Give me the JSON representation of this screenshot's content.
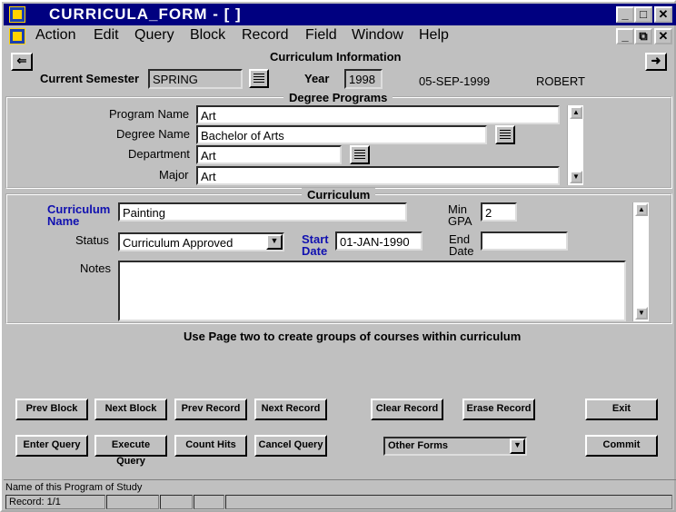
{
  "window": {
    "title": "CURRICULA_FORM - [ ]",
    "minimize": "_",
    "maximize": "□",
    "close": "✕",
    "child_minimize": "_",
    "child_restore": "⧉",
    "child_close": "✕"
  },
  "menu": [
    "Action",
    "Edit",
    "Query",
    "Block",
    "Record",
    "Field",
    "Window",
    "Help"
  ],
  "header": {
    "title": "Curriculum Information",
    "prev_arrow": "⇐",
    "next_arrow": "➜",
    "semester_label": "Current Semester",
    "semester_value": "SPRING",
    "year_label": "Year",
    "year_value": "1998",
    "date": "05-SEP-1999",
    "user": "ROBERT"
  },
  "degree": {
    "title": "Degree Programs",
    "program_name_label": "Program Name",
    "program_name": "Art",
    "degree_name_label": "Degree Name",
    "degree_name": "Bachelor of Arts",
    "department_label": "Department",
    "department": "Art",
    "major_label": "Major",
    "major": "Art"
  },
  "curriculum": {
    "title": "Curriculum",
    "name_label_1": "Curriculum",
    "name_label_2": "Name",
    "name": "Painting",
    "min_gpa_label_1": "Min",
    "min_gpa_label_2": "GPA",
    "min_gpa": "2",
    "status_label": "Status",
    "status": "Curriculum Approved",
    "start_label_1": "Start",
    "start_label_2": "Date",
    "start_date": "01-JAN-1990",
    "end_label_1": "End",
    "end_label_2": "Date",
    "end_date": "",
    "notes_label": "Notes",
    "notes": ""
  },
  "hint": "Use Page two to create groups of courses within curriculum",
  "buttons": {
    "prev_block": "Prev Block",
    "next_block": "Next Block",
    "prev_record": "Prev Record",
    "next_record": "Next Record",
    "clear_record": "Clear Record",
    "erase_record": "Erase Record",
    "exit": "Exit",
    "enter_query": "Enter Query",
    "execute_query": "Execute Query",
    "count_hits": "Count Hits",
    "cancel_query": "Cancel Query",
    "other_forms": "Other Forms",
    "commit": "Commit"
  },
  "status_bar": {
    "message": "Name of this Program of Study",
    "record": "Record: 1/1"
  }
}
